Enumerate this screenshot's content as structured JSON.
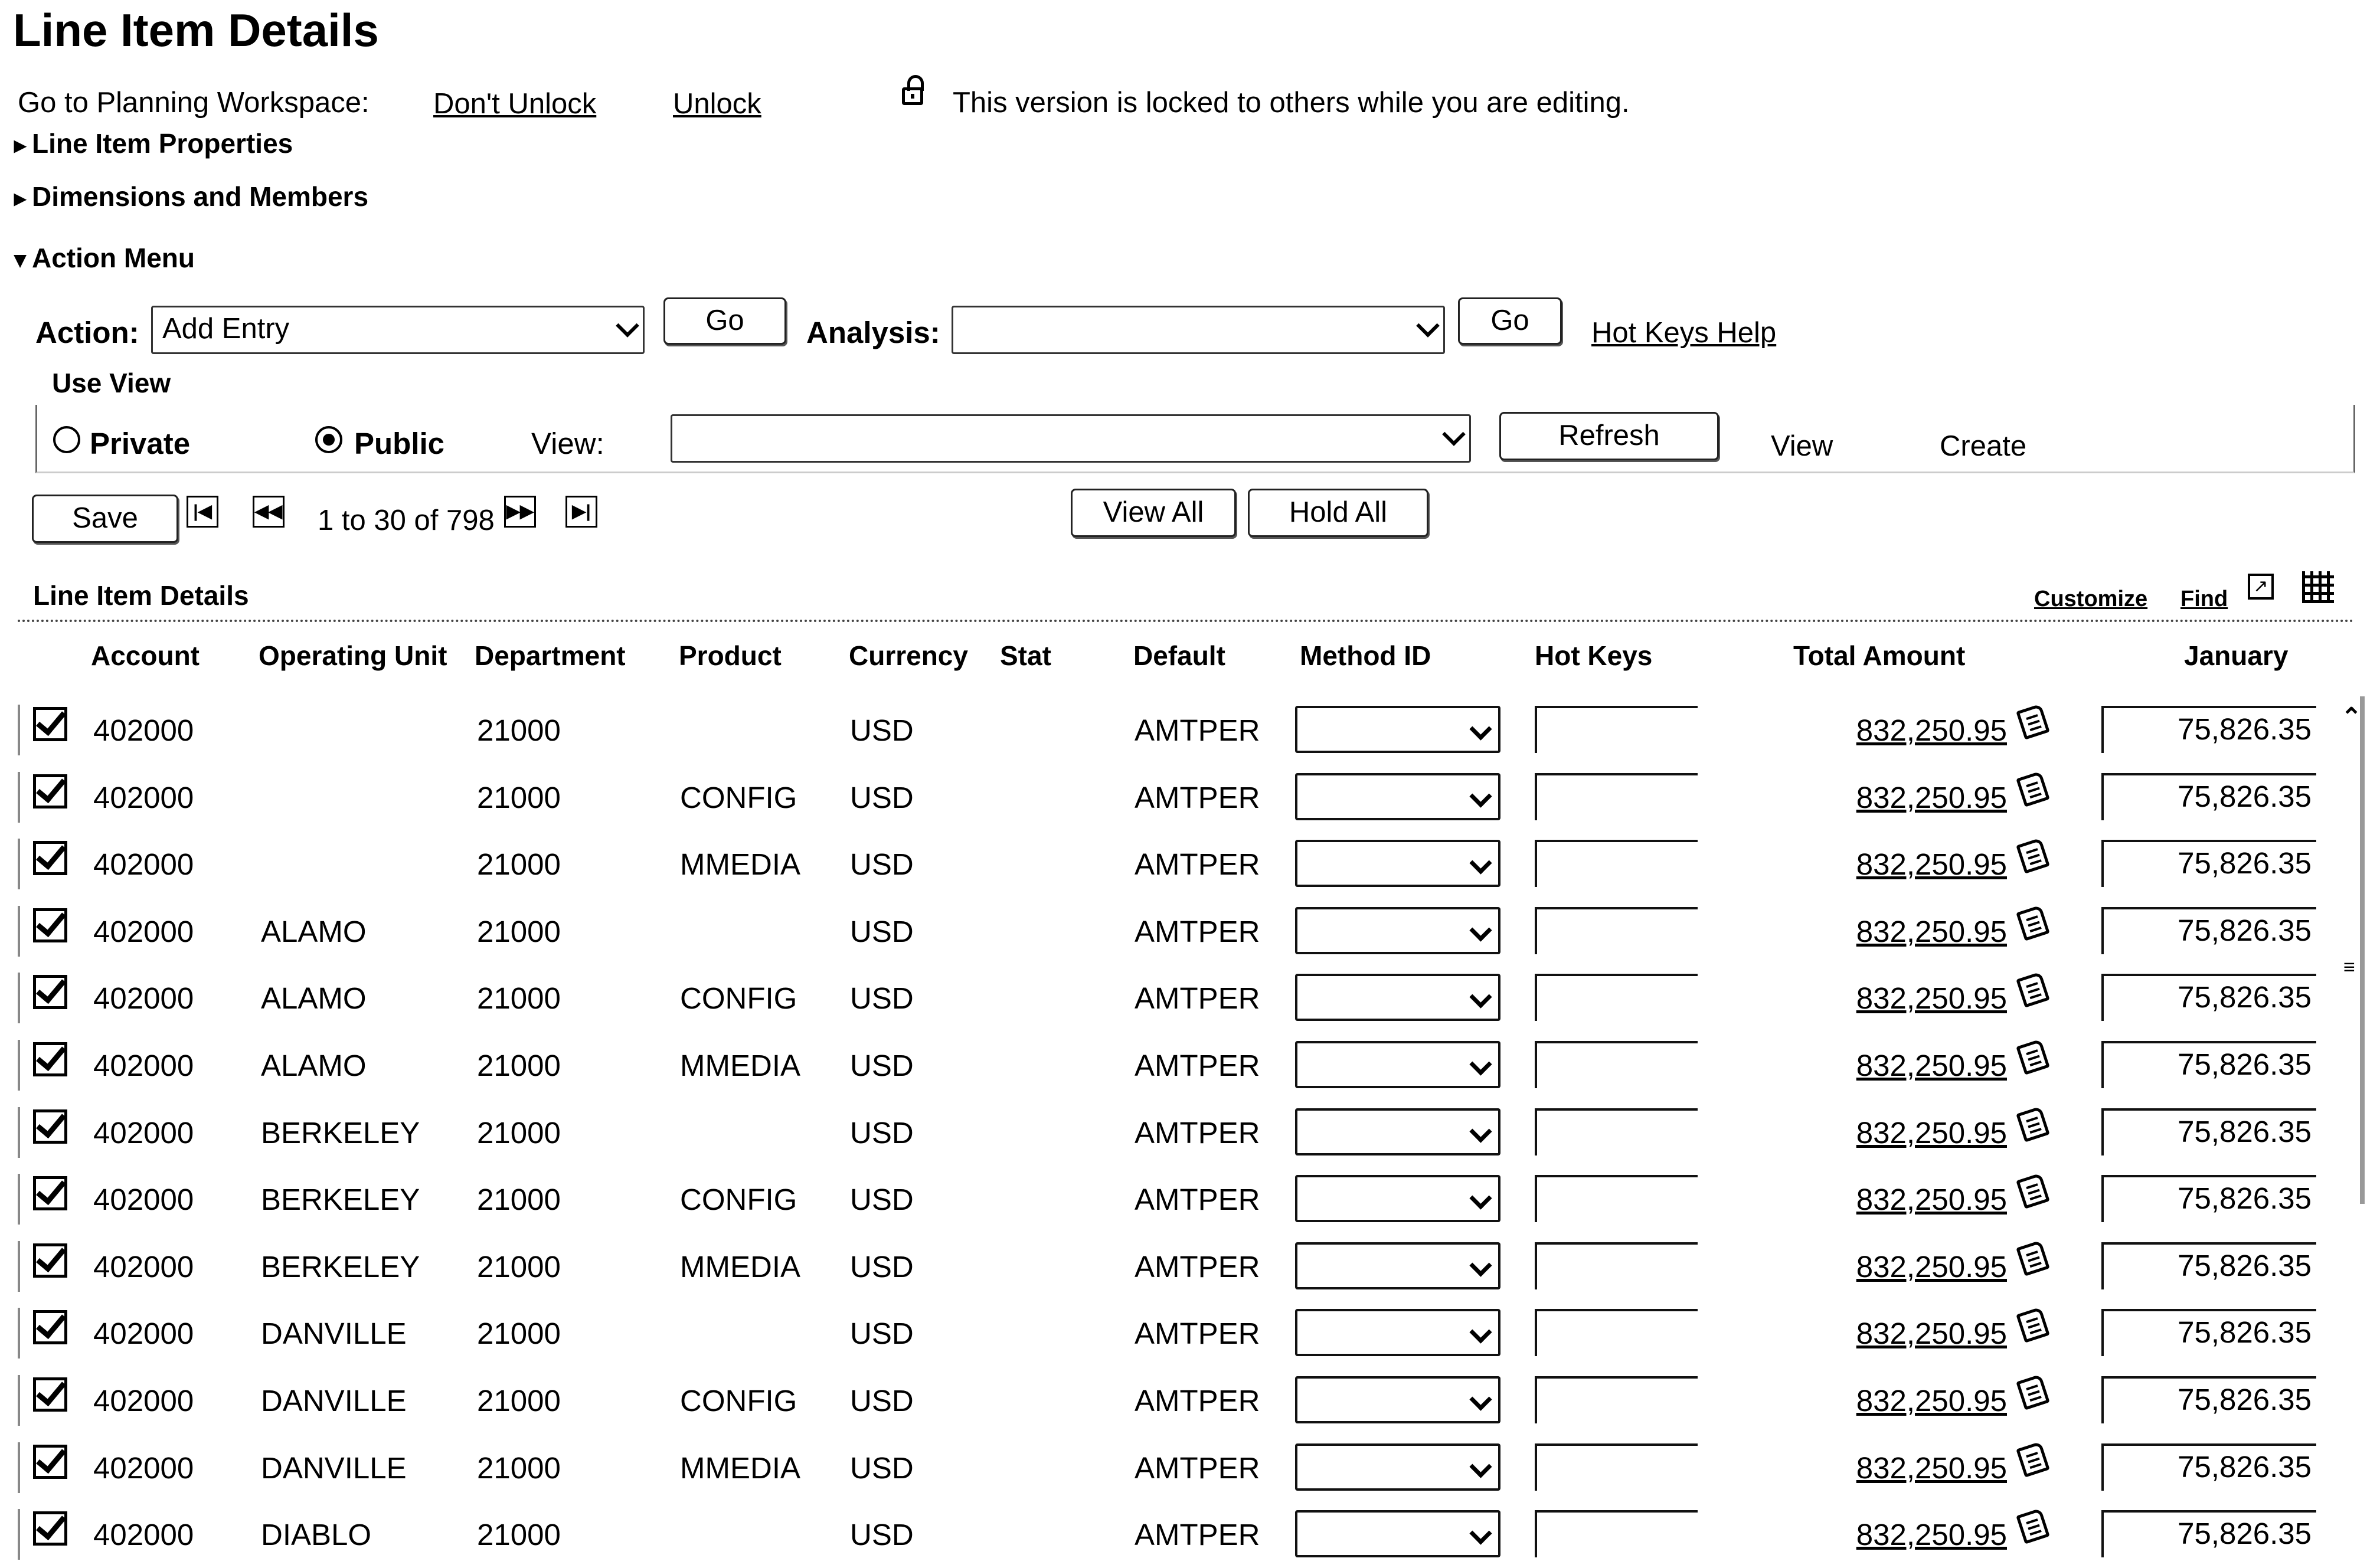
{
  "page": {
    "title": "Line Item Details",
    "workspace_label": "Go to Planning Workspace:",
    "dont_unlock": "Don't Unlock",
    "unlock": "Unlock",
    "lock_message": "This version is locked to others while you are editing."
  },
  "sections": {
    "line_item_properties": "Line Item Properties",
    "dimensions_members": "Dimensions and Members",
    "action_menu": "Action Menu",
    "use_view": "Use View",
    "line_item_details": "Line Item Details"
  },
  "action_bar": {
    "action_label": "Action:",
    "action_value": "Add Entry",
    "go1": "Go",
    "analysis_label": "Analysis:",
    "analysis_value": "",
    "go2": "Go",
    "hot_keys_help": "Hot Keys Help"
  },
  "view_bar": {
    "private": "Private",
    "public": "Public",
    "selected": "public",
    "view_label": "View:",
    "view_value": "",
    "refresh": "Refresh",
    "view_link": "View",
    "create_link": "Create"
  },
  "pager": {
    "save": "Save",
    "range": "1 to 30 of 798",
    "view_all": "View All",
    "hold_all": "Hold All"
  },
  "grid_toolbar": {
    "customize": "Customize",
    "find": "Find"
  },
  "columns": [
    "Account",
    "Operating Unit",
    "Department",
    "Product",
    "Currency",
    "Stat",
    "Default",
    "Method ID",
    "Hot Keys",
    "Total Amount",
    "January"
  ],
  "rows": [
    {
      "account": "402000",
      "unit": "",
      "dept": "21000",
      "product": "",
      "currency": "USD",
      "default": "AMTPER",
      "total": "832,250.95",
      "jan": "75,826.35"
    },
    {
      "account": "402000",
      "unit": "",
      "dept": "21000",
      "product": "CONFIG",
      "currency": "USD",
      "default": "AMTPER",
      "total": "832,250.95",
      "jan": "75,826.35"
    },
    {
      "account": "402000",
      "unit": "",
      "dept": "21000",
      "product": "MMEDIA",
      "currency": "USD",
      "default": "AMTPER",
      "total": "832,250.95",
      "jan": "75,826.35"
    },
    {
      "account": "402000",
      "unit": "ALAMO",
      "dept": "21000",
      "product": "",
      "currency": "USD",
      "default": "AMTPER",
      "total": "832,250.95",
      "jan": "75,826.35"
    },
    {
      "account": "402000",
      "unit": "ALAMO",
      "dept": "21000",
      "product": "CONFIG",
      "currency": "USD",
      "default": "AMTPER",
      "total": "832,250.95",
      "jan": "75,826.35"
    },
    {
      "account": "402000",
      "unit": "ALAMO",
      "dept": "21000",
      "product": "MMEDIA",
      "currency": "USD",
      "default": "AMTPER",
      "total": "832,250.95",
      "jan": "75,826.35"
    },
    {
      "account": "402000",
      "unit": "BERKELEY",
      "dept": "21000",
      "product": "",
      "currency": "USD",
      "default": "AMTPER",
      "total": "832,250.95",
      "jan": "75,826.35"
    },
    {
      "account": "402000",
      "unit": "BERKELEY",
      "dept": "21000",
      "product": "CONFIG",
      "currency": "USD",
      "default": "AMTPER",
      "total": "832,250.95",
      "jan": "75,826.35"
    },
    {
      "account": "402000",
      "unit": "BERKELEY",
      "dept": "21000",
      "product": "MMEDIA",
      "currency": "USD",
      "default": "AMTPER",
      "total": "832,250.95",
      "jan": "75,826.35"
    },
    {
      "account": "402000",
      "unit": "DANVILLE",
      "dept": "21000",
      "product": "",
      "currency": "USD",
      "default": "AMTPER",
      "total": "832,250.95",
      "jan": "75,826.35"
    },
    {
      "account": "402000",
      "unit": "DANVILLE",
      "dept": "21000",
      "product": "CONFIG",
      "currency": "USD",
      "default": "AMTPER",
      "total": "832,250.95",
      "jan": "75,826.35"
    },
    {
      "account": "402000",
      "unit": "DANVILLE",
      "dept": "21000",
      "product": "MMEDIA",
      "currency": "USD",
      "default": "AMTPER",
      "total": "832,250.95",
      "jan": "75,826.35"
    },
    {
      "account": "402000",
      "unit": "DIABLO",
      "dept": "21000",
      "product": "",
      "currency": "USD",
      "default": "AMTPER",
      "total": "832,250.95",
      "jan": "75,826.35"
    }
  ]
}
